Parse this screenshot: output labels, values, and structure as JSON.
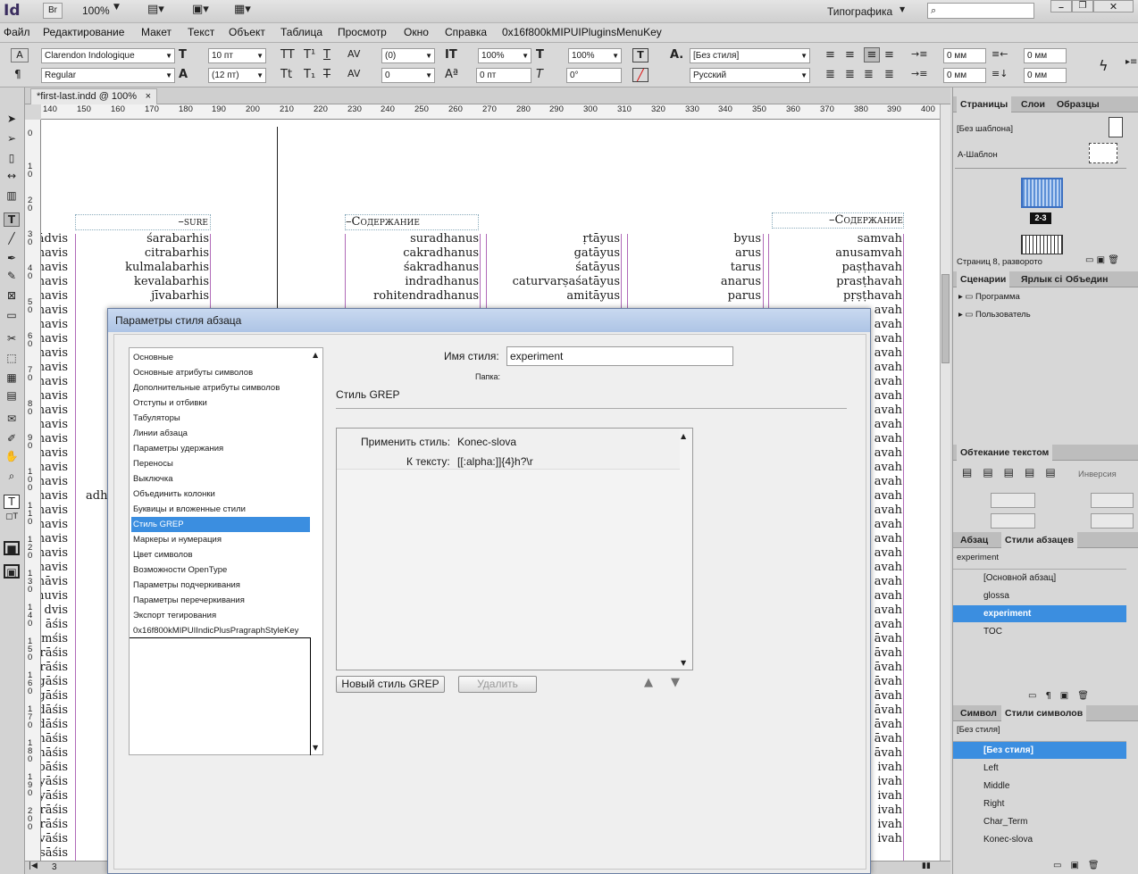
{
  "app": {
    "logo": "Id",
    "br_label": "Br",
    "zoom": "100%",
    "workspace": "Типографика",
    "search_placeholder": ""
  },
  "menu": [
    "Файл",
    "Редактирование",
    "Макет",
    "Текст",
    "Объект",
    "Таблица",
    "Просмотр",
    "Окно",
    "Справка",
    "0x16f800kMIPUIPluginsMenuKey"
  ],
  "control": {
    "font_family": "Clarendon Indologique",
    "font_style": "Regular",
    "font_size": "10 пт",
    "leading": "(12 пт)",
    "tracking": "(0)",
    "kerning": "0",
    "vscale": "100%",
    "hscale": "100%",
    "baseline": "0 пт",
    "skew": "0°",
    "char_style": "[Без стиля]",
    "language": "Русский",
    "indent_left": "0 мм",
    "indent_right": "0 мм",
    "indent_first": "0 мм",
    "space_after": "0 мм"
  },
  "document": {
    "tab_label": "*first-last.indd @ 100%",
    "ruler_h": [
      "140",
      "150",
      "160",
      "170",
      "180",
      "190",
      "200",
      "210",
      "220",
      "230",
      "240",
      "250",
      "260",
      "270",
      "280",
      "290",
      "300",
      "310",
      "320",
      "330",
      "340",
      "350",
      "360",
      "370",
      "380",
      "390",
      "400"
    ],
    "ruler_v": [
      "0",
      "1 0",
      "2 0",
      "3 0",
      "4 0",
      "5 0",
      "6 0",
      "7 0",
      "8 0",
      "9 0",
      "1 0 0",
      "1 1 0",
      "1 2 0",
      "1 3 0",
      "1 4 0",
      "1 5 0",
      "1 6 0",
      "1 7 0",
      "1 8 0",
      "1 9 0",
      "2 0 0"
    ],
    "headers": [
      "–sure",
      "–Содержание",
      "–Содержание"
    ],
    "col_left": [
      "ādvis",
      "navis",
      "navis",
      "navis",
      "navis",
      "navis",
      "navis",
      "navis",
      "navis",
      "navis",
      "navis",
      "navis",
      "navis",
      "navis",
      "navis",
      "navis",
      "navis",
      "navis",
      "navis",
      "navis",
      "navis",
      "navis",
      "navis",
      "navis",
      "nāvis",
      "nuvis",
      "dvis",
      "āśis",
      "mśis",
      "rāśis",
      "rāśis",
      "gāśis",
      "gāśis",
      "dāśis",
      "dāśis",
      "nāśis",
      "nāśis",
      "pāśis",
      "yāśis",
      "yāśis",
      "rāśis",
      "rāśis",
      "vāśis",
      "sāśis"
    ],
    "col_left_extra": "adh",
    "col1": [
      "śarabarhis",
      "citrabarhis",
      "kulmalabarhis",
      "kevalabarhis",
      "jīvabarhis"
    ],
    "col2": [
      "suradhanus",
      "cakradhanus",
      "śakradhanus",
      "indradhanus",
      "rohitendradhanus"
    ],
    "col3": [
      "ṛtāyus",
      "gatāyus",
      "śatāyus",
      "caturvarṣaśatāyus",
      "amitāyus"
    ],
    "col4": [
      "byus",
      "arus",
      "tarus",
      "anarus",
      "parus"
    ],
    "col5": [
      "samvah",
      "anusamvah",
      "paṣṭhavah",
      "prasṭhavah",
      "pṛṣṭhavah",
      "avah",
      "avah",
      "avah",
      "avah",
      "avah",
      "avah",
      "avah",
      "avah",
      "avah",
      "avah",
      "avah",
      "avah",
      "avah",
      "avah",
      "avah",
      "avah",
      "avah",
      "avah",
      "avah",
      "avah",
      "avah",
      "avah",
      "avah",
      "āvah",
      "āvah",
      "āvah",
      "āvah",
      "āvah",
      "āvah",
      "āvah",
      "āvah",
      "āvah",
      "ivah",
      "ivah",
      "ivah",
      "ivah",
      "ivah",
      "ivah"
    ],
    "page_number": "3"
  },
  "panels": {
    "pages": {
      "tabs": [
        "Страницы",
        "Слои",
        "Образцы"
      ],
      "no_master": "[Без шаблона]",
      "a_master": "А-Шаблон",
      "spread_label": "2-3",
      "status": "Страниц 8, разворото"
    },
    "scripts": {
      "tabs": [
        "Сценарии",
        "Ярлык сі",
        "Объедин"
      ],
      "items": [
        "Программа",
        "Пользователь"
      ]
    },
    "wrap": {
      "title": "Обтекание текстом",
      "invert_label": "Инверсия"
    },
    "para_styles": {
      "tabs": [
        "Абзац",
        "Стили абзацев"
      ],
      "current": "experiment",
      "items": [
        "[Основной абзац]",
        "glossa",
        "experiment",
        "TOC"
      ],
      "selected_index": 2
    },
    "char_styles": {
      "tabs": [
        "Символ",
        "Стили символов"
      ],
      "current": "[Без стиля]",
      "items": [
        "[Без стиля]",
        "Left",
        "Middle",
        "Right",
        "Char_Term",
        "Konec-slova"
      ],
      "selected_index": 0
    }
  },
  "dialog": {
    "title": "Параметры стиля абзаца",
    "categories": [
      "Основные",
      "Основные атрибуты символов",
      "Дополнительные атрибуты символов",
      "Отступы и отбивки",
      "Табуляторы",
      "Линии абзаца",
      "Параметры удержания",
      "Переносы",
      "Выключка",
      "Объединить колонки",
      "Буквицы и вложенные стили",
      "Стиль GREP",
      "Маркеры и нумерация",
      "Цвет символов",
      "Возможности OpenType",
      "Параметры подчеркивания",
      "Параметры перечеркивания",
      "Экспорт тегирования",
      "0x16f800kMIPUIIndicPlusPragraphStyleKey"
    ],
    "selected_category": 11,
    "style_name_label": "Имя стиля:",
    "style_name": "experiment",
    "folder_label": "Папка:",
    "section_title": "Стиль GREP",
    "grep_apply_label": "Применить стиль:",
    "grep_apply_value": "Konec-slova",
    "grep_text_label": "К тексту:",
    "grep_text_value": "[[:alpha:]]{4}h?\\r",
    "new_grep_button": "Новый стиль GREP",
    "delete_button": "Удалить"
  }
}
